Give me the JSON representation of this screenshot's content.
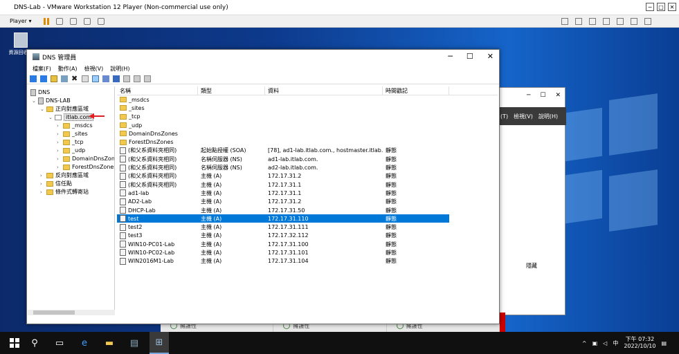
{
  "vm": {
    "title": "DNS-Lab - VMware Workstation 12 Player (Non-commercial use only)",
    "player_menu": "Player ▾",
    "window_buttons": [
      "─",
      "□",
      "✕"
    ]
  },
  "desktop": {
    "recycle_bin_label": "資源回收筒"
  },
  "dns_window": {
    "title": "DNS 管理員",
    "window_buttons": [
      "─",
      "☐",
      "✕"
    ],
    "menu": [
      "檔案(F)",
      "動作(A)",
      "檢視(V)",
      "說明(H)"
    ],
    "tree": {
      "root": "DNS",
      "server": "DNS-LAB",
      "forward_zones": "正向對應區域",
      "zone": "itlab.com",
      "zone_children": [
        "_msdcs",
        "_sites",
        "_tcp",
        "_udp",
        "DomainDnsZones",
        "ForestDnsZones"
      ],
      "reverse_zones": "反向對應區域",
      "trust_points": "信任點",
      "conditional_forwarders": "條件式轉寄站"
    },
    "columns": [
      "名稱",
      "類型",
      "資料",
      "時間戳記"
    ],
    "rows": [
      {
        "name": "_msdcs",
        "type": "",
        "data": "",
        "ts": "",
        "icon": "folder"
      },
      {
        "name": "_sites",
        "type": "",
        "data": "",
        "ts": "",
        "icon": "folder"
      },
      {
        "name": "_tcp",
        "type": "",
        "data": "",
        "ts": "",
        "icon": "folder"
      },
      {
        "name": "_udp",
        "type": "",
        "data": "",
        "ts": "",
        "icon": "folder"
      },
      {
        "name": "DomainDnsZones",
        "type": "",
        "data": "",
        "ts": "",
        "icon": "folder"
      },
      {
        "name": "ForestDnsZones",
        "type": "",
        "data": "",
        "ts": "",
        "icon": "folder"
      },
      {
        "name": "(和父系資料夾相同)",
        "type": "起始點授權 (SOA)",
        "data": "[78], ad1-lab.itlab.com., hostmaster.itlab.c...",
        "ts": "靜態",
        "icon": "record"
      },
      {
        "name": "(和父系資料夾相同)",
        "type": "名稱伺服器 (NS)",
        "data": "ad1-lab.itlab.com.",
        "ts": "靜態",
        "icon": "record"
      },
      {
        "name": "(和父系資料夾相同)",
        "type": "名稱伺服器 (NS)",
        "data": "ad2-lab.itlab.com.",
        "ts": "靜態",
        "icon": "record"
      },
      {
        "name": "(和父系資料夾相同)",
        "type": "主機 (A)",
        "data": "172.17.31.2",
        "ts": "靜態",
        "icon": "record"
      },
      {
        "name": "(和父系資料夾相同)",
        "type": "主機 (A)",
        "data": "172.17.31.1",
        "ts": "靜態",
        "icon": "record"
      },
      {
        "name": "ad1-lab",
        "type": "主機 (A)",
        "data": "172.17.31.1",
        "ts": "靜態",
        "icon": "record"
      },
      {
        "name": "AD2-Lab",
        "type": "主機 (A)",
        "data": "172.17.31.2",
        "ts": "靜態",
        "icon": "record"
      },
      {
        "name": "DHCP-Lab",
        "type": "主機 (A)",
        "data": "172.17.31.50",
        "ts": "靜態",
        "icon": "record"
      },
      {
        "name": "test",
        "type": "主機 (A)",
        "data": "172.17.31.110",
        "ts": "靜態",
        "icon": "record",
        "selected": true
      },
      {
        "name": "test2",
        "type": "主機 (A)",
        "data": "172.17.31.111",
        "ts": "靜態",
        "icon": "record"
      },
      {
        "name": "test3",
        "type": "主機 (A)",
        "data": "172.17.32.112",
        "ts": "靜態",
        "icon": "record"
      },
      {
        "name": "WIN10-PC01-Lab",
        "type": "主機 (A)",
        "data": "172.17.31.100",
        "ts": "靜態",
        "icon": "record"
      },
      {
        "name": "WIN10-PC02-Lab",
        "type": "主機 (A)",
        "data": "172.17.31.101",
        "ts": "靜態",
        "icon": "record"
      },
      {
        "name": "WIN2016M1-Lab",
        "type": "主機 (A)",
        "data": "172.17.31.104",
        "ts": "靜態",
        "icon": "record"
      }
    ]
  },
  "background_window": {
    "menu": [
      "(T)",
      "檢視(V)",
      "說明(H)"
    ],
    "hidden_label": "隱藏",
    "bottom_cells": [
      "擁護性",
      "擁護性",
      "擁護性"
    ]
  },
  "taskbar": {
    "time": "下午 07:32",
    "date": "2022/10/10",
    "ime": "中"
  },
  "colors": {
    "selection": "#0078d7",
    "arrow": "#e02020"
  }
}
